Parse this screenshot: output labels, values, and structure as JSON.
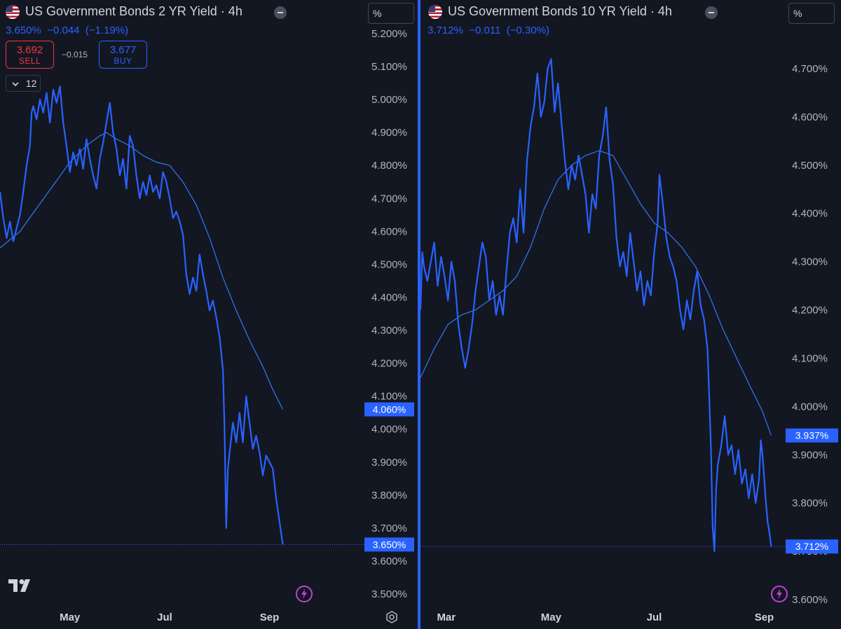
{
  "charts": [
    {
      "title": "US Government Bonds 2 YR Yield · 4h",
      "quote": {
        "last": "3.650%",
        "change": "−0.044",
        "change_pct": "(−1.19%)"
      },
      "sell": {
        "price": "3.692",
        "label": "SELL"
      },
      "buy": {
        "price": "3.677",
        "label": "BUY"
      },
      "spread": "−0.015",
      "interval_value": "12",
      "unit_button": "%",
      "tag_ma": "4.060%",
      "tag_last": "3.650%"
    },
    {
      "title": "US Government Bonds 10 YR Yield · 4h",
      "quote": {
        "last": "3.712%",
        "change": "−0.011",
        "change_pct": "(−0.30%)"
      },
      "unit_button": "%",
      "tag_ma": "3.937%",
      "tag_last": "3.712%"
    }
  ],
  "colors": {
    "background": "#131722",
    "series": "#2962ff",
    "ma": "#3179f5",
    "sell": "#f23645",
    "buy": "#2962ff",
    "bolt": "#c040d6"
  },
  "icons": [
    "us-flag-icon",
    "minus-icon",
    "chevron-down-icon",
    "tradingview-logo",
    "lightning-icon",
    "gear-icon"
  ],
  "chart_data": [
    {
      "type": "line",
      "title": "US Government Bonds 2 YR Yield · 4h",
      "ylim": [
        3.46,
        5.24
      ],
      "y_ticks": [
        5.2,
        5.1,
        5.0,
        4.9,
        4.8,
        4.7,
        4.6,
        4.5,
        4.4,
        4.3,
        4.2,
        4.1,
        4.0,
        3.9,
        3.8,
        3.7,
        3.6,
        3.5
      ],
      "y_tick_labels": [
        "5.200%",
        "5.100%",
        "5.000%",
        "4.900%",
        "4.800%",
        "4.700%",
        "4.600%",
        "4.500%",
        "4.400%",
        "4.300%",
        "4.200%",
        "4.100%",
        "4.000%",
        "3.900%",
        "3.800%",
        "3.700%",
        "3.600%",
        "3.500%"
      ],
      "x_labels": [
        "May",
        "Jul",
        "Sep"
      ],
      "x_label_positions": [
        30,
        87,
        150
      ],
      "x_range": [
        -12,
        170
      ],
      "grid": false,
      "series": [
        {
          "name": "",
          "values": [
            [
              -12,
              4.72
            ],
            [
              -10,
              4.64
            ],
            [
              -8,
              4.58
            ],
            [
              -6,
              4.63
            ],
            [
              -4,
              4.57
            ],
            [
              -2,
              4.61
            ],
            [
              0,
              4.65
            ],
            [
              2,
              4.72
            ],
            [
              4,
              4.8
            ],
            [
              6,
              4.86
            ],
            [
              7,
              4.96
            ],
            [
              8,
              4.98
            ],
            [
              10,
              4.94
            ],
            [
              12,
              5.0
            ],
            [
              14,
              4.96
            ],
            [
              16,
              5.02
            ],
            [
              18,
              4.93
            ],
            [
              20,
              5.03
            ],
            [
              22,
              4.99
            ],
            [
              24,
              5.04
            ],
            [
              26,
              4.93
            ],
            [
              28,
              4.86
            ],
            [
              30,
              4.78
            ],
            [
              32,
              4.84
            ],
            [
              34,
              4.8
            ],
            [
              36,
              4.85
            ],
            [
              38,
              4.79
            ],
            [
              40,
              4.88
            ],
            [
              42,
              4.82
            ],
            [
              44,
              4.77
            ],
            [
              46,
              4.73
            ],
            [
              48,
              4.82
            ],
            [
              50,
              4.87
            ],
            [
              52,
              4.93
            ],
            [
              54,
              4.99
            ],
            [
              56,
              4.9
            ],
            [
              58,
              4.85
            ],
            [
              60,
              4.77
            ],
            [
              62,
              4.82
            ],
            [
              64,
              4.73
            ],
            [
              66,
              4.89
            ],
            [
              68,
              4.86
            ],
            [
              70,
              4.77
            ],
            [
              72,
              4.7
            ],
            [
              74,
              4.75
            ],
            [
              76,
              4.71
            ],
            [
              78,
              4.77
            ],
            [
              80,
              4.72
            ],
            [
              82,
              4.74
            ],
            [
              84,
              4.7
            ],
            [
              86,
              4.78
            ],
            [
              88,
              4.75
            ],
            [
              90,
              4.7
            ],
            [
              92,
              4.64
            ],
            [
              94,
              4.66
            ],
            [
              96,
              4.63
            ],
            [
              98,
              4.59
            ],
            [
              100,
              4.47
            ],
            [
              102,
              4.41
            ],
            [
              104,
              4.46
            ],
            [
              106,
              4.42
            ],
            [
              108,
              4.53
            ],
            [
              110,
              4.47
            ],
            [
              112,
              4.42
            ],
            [
              114,
              4.36
            ],
            [
              116,
              4.39
            ],
            [
              118,
              4.34
            ],
            [
              120,
              4.28
            ],
            [
              122,
              4.18
            ],
            [
              123,
              4.0
            ],
            [
              124,
              3.7
            ],
            [
              125,
              3.88
            ],
            [
              126,
              3.93
            ],
            [
              128,
              4.02
            ],
            [
              130,
              3.96
            ],
            [
              132,
              4.05
            ],
            [
              134,
              3.96
            ],
            [
              136,
              4.1
            ],
            [
              138,
              4.02
            ],
            [
              140,
              3.94
            ],
            [
              142,
              3.98
            ],
            [
              144,
              3.93
            ],
            [
              146,
              3.86
            ],
            [
              148,
              3.92
            ],
            [
              150,
              3.9
            ],
            [
              152,
              3.88
            ],
            [
              154,
              3.79
            ],
            [
              156,
              3.72
            ],
            [
              158,
              3.65
            ]
          ]
        },
        {
          "name": "",
          "values": [
            [
              -12,
              4.55
            ],
            [
              0,
              4.6
            ],
            [
              10,
              4.67
            ],
            [
              20,
              4.74
            ],
            [
              30,
              4.81
            ],
            [
              40,
              4.86
            ],
            [
              48,
              4.89
            ],
            [
              52,
              4.9
            ],
            [
              58,
              4.88
            ],
            [
              66,
              4.86
            ],
            [
              74,
              4.83
            ],
            [
              82,
              4.81
            ],
            [
              90,
              4.8
            ],
            [
              98,
              4.75
            ],
            [
              106,
              4.68
            ],
            [
              114,
              4.58
            ],
            [
              122,
              4.46
            ],
            [
              130,
              4.36
            ],
            [
              138,
              4.27
            ],
            [
              146,
              4.19
            ],
            [
              152,
              4.12
            ],
            [
              158,
              4.06
            ]
          ]
        }
      ]
    },
    {
      "type": "line",
      "title": "US Government Bonds 10 YR Yield · 4h",
      "ylim": [
        3.58,
        4.78
      ],
      "y_ticks": [
        4.7,
        4.6,
        4.5,
        4.4,
        4.3,
        4.2,
        4.1,
        4.0,
        3.9,
        3.8,
        3.7,
        3.6
      ],
      "y_tick_labels": [
        "4.700%",
        "4.600%",
        "4.500%",
        "4.400%",
        "4.300%",
        "4.200%",
        "4.100%",
        "4.000%",
        "3.900%",
        "3.800%",
        "3.700%",
        "3.600%"
      ],
      "x_labels": [
        "Mar",
        "May",
        "Jul",
        "Sep"
      ],
      "x_label_positions": [
        10,
        71,
        131,
        195
      ],
      "x_range": [
        -5,
        205
      ],
      "grid": false,
      "series": [
        {
          "name": "",
          "values": [
            [
              -5,
              4.2
            ],
            [
              -4,
              4.32
            ],
            [
              -3,
              4.29
            ],
            [
              -1,
              4.26
            ],
            [
              1,
              4.3
            ],
            [
              3,
              4.34
            ],
            [
              5,
              4.25
            ],
            [
              7,
              4.31
            ],
            [
              9,
              4.27
            ],
            [
              11,
              4.22
            ],
            [
              13,
              4.3
            ],
            [
              15,
              4.26
            ],
            [
              17,
              4.17
            ],
            [
              19,
              4.12
            ],
            [
              21,
              4.08
            ],
            [
              23,
              4.12
            ],
            [
              25,
              4.17
            ],
            [
              27,
              4.24
            ],
            [
              29,
              4.29
            ],
            [
              31,
              4.34
            ],
            [
              33,
              4.31
            ],
            [
              35,
              4.22
            ],
            [
              37,
              4.26
            ],
            [
              39,
              4.19
            ],
            [
              41,
              4.23
            ],
            [
              43,
              4.19
            ],
            [
              45,
              4.28
            ],
            [
              47,
              4.36
            ],
            [
              49,
              4.39
            ],
            [
              51,
              4.34
            ],
            [
              53,
              4.45
            ],
            [
              55,
              4.36
            ],
            [
              57,
              4.51
            ],
            [
              59,
              4.58
            ],
            [
              61,
              4.62
            ],
            [
              63,
              4.69
            ],
            [
              64,
              4.65
            ],
            [
              65,
              4.6
            ],
            [
              67,
              4.63
            ],
            [
              69,
              4.7
            ],
            [
              71,
              4.72
            ],
            [
              73,
              4.61
            ],
            [
              75,
              4.67
            ],
            [
              77,
              4.59
            ],
            [
              79,
              4.51
            ],
            [
              81,
              4.45
            ],
            [
              83,
              4.5
            ],
            [
              85,
              4.47
            ],
            [
              87,
              4.52
            ],
            [
              89,
              4.48
            ],
            [
              91,
              4.44
            ],
            [
              93,
              4.36
            ],
            [
              95,
              4.44
            ],
            [
              97,
              4.41
            ],
            [
              99,
              4.52
            ],
            [
              101,
              4.56
            ],
            [
              103,
              4.62
            ],
            [
              105,
              4.51
            ],
            [
              107,
              4.46
            ],
            [
              109,
              4.35
            ],
            [
              111,
              4.29
            ],
            [
              113,
              4.32
            ],
            [
              115,
              4.27
            ],
            [
              117,
              4.36
            ],
            [
              119,
              4.3
            ],
            [
              121,
              4.24
            ],
            [
              123,
              4.28
            ],
            [
              125,
              4.21
            ],
            [
              127,
              4.26
            ],
            [
              129,
              4.23
            ],
            [
              131,
              4.32
            ],
            [
              133,
              4.38
            ],
            [
              134,
              4.48
            ],
            [
              136,
              4.42
            ],
            [
              138,
              4.35
            ],
            [
              140,
              4.31
            ],
            [
              142,
              4.29
            ],
            [
              144,
              4.26
            ],
            [
              146,
              4.2
            ],
            [
              148,
              4.16
            ],
            [
              150,
              4.22
            ],
            [
              152,
              4.18
            ],
            [
              154,
              4.24
            ],
            [
              156,
              4.28
            ],
            [
              158,
              4.21
            ],
            [
              160,
              4.18
            ],
            [
              162,
              4.12
            ],
            [
              163,
              4.02
            ],
            [
              164,
              3.91
            ],
            [
              165,
              3.75
            ],
            [
              166,
              3.7
            ],
            [
              167,
              3.83
            ],
            [
              168,
              3.88
            ],
            [
              170,
              3.92
            ],
            [
              172,
              3.98
            ],
            [
              174,
              3.9
            ],
            [
              176,
              3.92
            ],
            [
              178,
              3.86
            ],
            [
              180,
              3.91
            ],
            [
              182,
              3.84
            ],
            [
              184,
              3.87
            ],
            [
              186,
              3.81
            ],
            [
              188,
              3.86
            ],
            [
              190,
              3.8
            ],
            [
              192,
              3.85
            ],
            [
              193,
              3.93
            ],
            [
              194,
              3.9
            ],
            [
              195,
              3.85
            ],
            [
              196,
              3.8
            ],
            [
              197,
              3.76
            ],
            [
              198,
              3.74
            ],
            [
              199,
              3.71
            ]
          ]
        },
        {
          "name": "",
          "values": [
            [
              -5,
              4.06
            ],
            [
              3,
              4.12
            ],
            [
              11,
              4.17
            ],
            [
              19,
              4.19
            ],
            [
              27,
              4.2
            ],
            [
              35,
              4.22
            ],
            [
              43,
              4.24
            ],
            [
              51,
              4.27
            ],
            [
              59,
              4.33
            ],
            [
              67,
              4.41
            ],
            [
              75,
              4.47
            ],
            [
              83,
              4.5
            ],
            [
              91,
              4.52
            ],
            [
              99,
              4.53
            ],
            [
              107,
              4.52
            ],
            [
              115,
              4.47
            ],
            [
              123,
              4.42
            ],
            [
              131,
              4.38
            ],
            [
              139,
              4.36
            ],
            [
              147,
              4.33
            ],
            [
              155,
              4.29
            ],
            [
              163,
              4.23
            ],
            [
              171,
              4.16
            ],
            [
              179,
              4.1
            ],
            [
              187,
              4.04
            ],
            [
              194,
              3.99
            ],
            [
              199,
              3.94
            ]
          ]
        }
      ]
    }
  ]
}
